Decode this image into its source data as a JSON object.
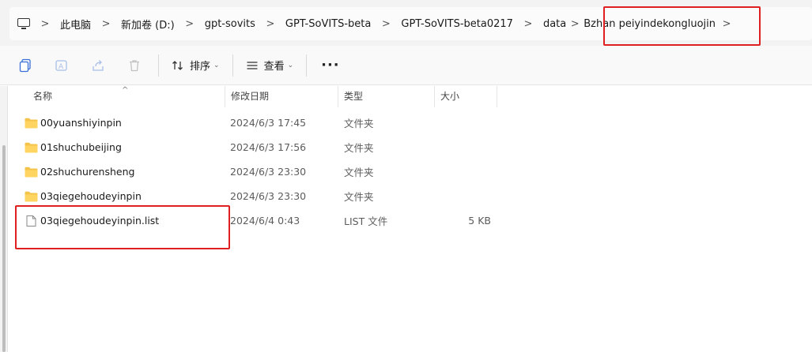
{
  "breadcrumb": {
    "items": [
      {
        "label": "此电脑"
      },
      {
        "label": "新加卷 (D:)"
      },
      {
        "label": "gpt-sovits"
      },
      {
        "label": "GPT-SoVITS-beta"
      },
      {
        "label": "GPT-SoVITS-beta0217"
      },
      {
        "label": "data"
      },
      {
        "label": "Bzhan peiyindekongluojin"
      }
    ],
    "separator": ">"
  },
  "toolbar": {
    "sort_label": "排序",
    "view_label": "查看",
    "more_label": "···",
    "chevron": "⌄"
  },
  "columns": {
    "name": "名称",
    "date": "修改日期",
    "type": "类型",
    "size": "大小",
    "sort_indicator": "^"
  },
  "files": [
    {
      "name": "00yuanshiyinpin",
      "date": "2024/6/3 17:45",
      "type": "文件夹",
      "size": "",
      "icon": "folder-icon"
    },
    {
      "name": "01shuchubeijing",
      "date": "2024/6/3 17:56",
      "type": "文件夹",
      "size": "",
      "icon": "folder-icon"
    },
    {
      "name": "02shuchurensheng",
      "date": "2024/6/3 23:30",
      "type": "文件夹",
      "size": "",
      "icon": "folder-icon"
    },
    {
      "name": "03qiegehoudeyinpin",
      "date": "2024/6/3 23:30",
      "type": "文件夹",
      "size": "",
      "icon": "folder-icon"
    },
    {
      "name": "03qiegehoudeyinpin.list",
      "date": "2024/6/4 0:43",
      "type": "LIST 文件",
      "size": "5 KB",
      "icon": "file-icon"
    }
  ],
  "colors": {
    "highlight": "#e02020",
    "folder": "#f4c34a"
  }
}
